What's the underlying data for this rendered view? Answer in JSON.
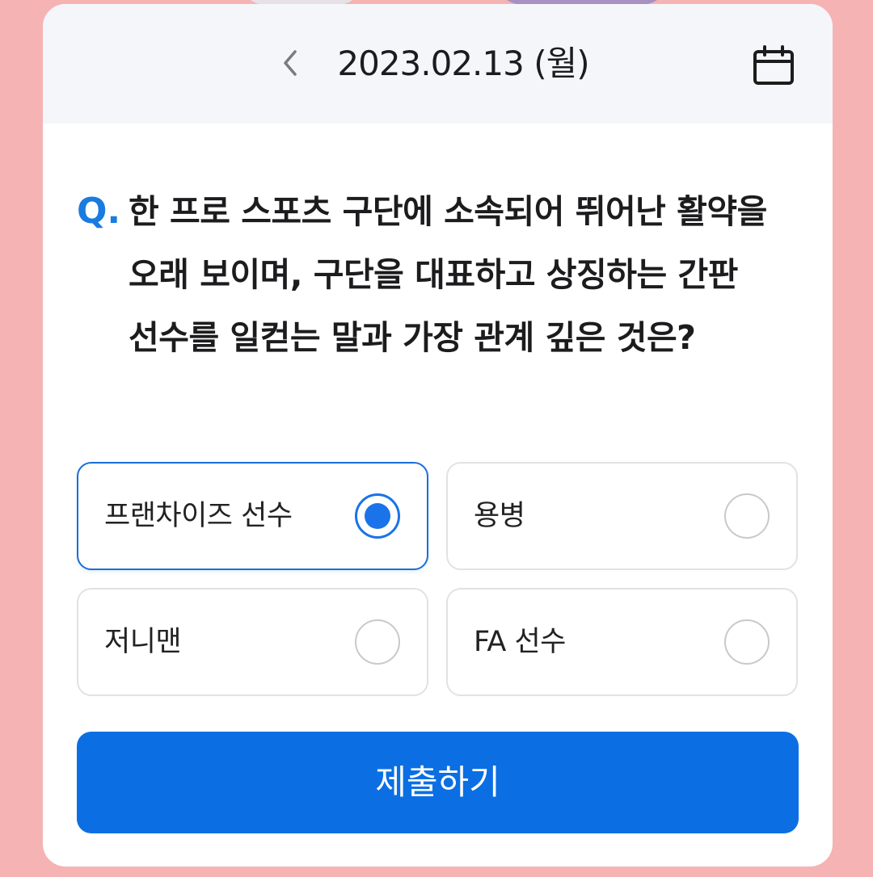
{
  "header": {
    "date": "2023.02.13 (월)",
    "prev_icon": "chevron-left-icon",
    "calendar_icon": "calendar-icon"
  },
  "question": {
    "prefix": "Q.",
    "text": "한 프로 스포츠 구단에 소속되어 뛰어난 활약을 오래 보이며, 구단을 대표하고 상징하는 간판 선수를 일컫는 말과 가장 관계 깊은 것은?"
  },
  "options": [
    {
      "label": "프랜차이즈 선수",
      "selected": true
    },
    {
      "label": "용병",
      "selected": false
    },
    {
      "label": "저니맨",
      "selected": false
    },
    {
      "label": "FA 선수",
      "selected": false
    }
  ],
  "submit_label": "제출하기",
  "colors": {
    "accent": "#0b6fe3",
    "background": "#f6b3b4",
    "question_prefix": "#1a7be0"
  }
}
